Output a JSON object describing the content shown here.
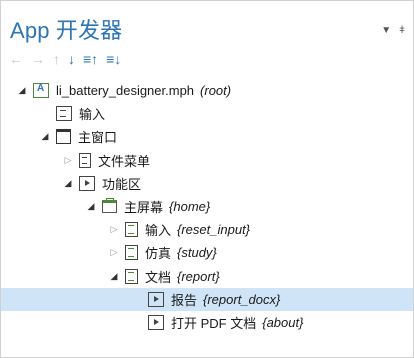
{
  "header": {
    "app": "App",
    "title": "开发器",
    "pin_icon": "pin-icon",
    "dropdown_icon": "chevron-down-icon"
  },
  "toolbar": {
    "buttons": [
      {
        "name": "back",
        "glyph": "←",
        "enabled": false
      },
      {
        "name": "forward",
        "glyph": "→",
        "enabled": false
      },
      {
        "name": "move-up",
        "glyph": "↑",
        "enabled": false
      },
      {
        "name": "move-down",
        "glyph": "↓",
        "enabled": true
      },
      {
        "name": "expand-all",
        "glyph": "≡↑",
        "enabled": true
      },
      {
        "name": "collapse-all",
        "glyph": "≡↓",
        "enabled": true
      }
    ]
  },
  "tree": [
    {
      "label": "li_battery_designer.mph",
      "tag": "(root)",
      "icon": "app-icon",
      "toggle": "open",
      "level": 0
    },
    {
      "label": "输入",
      "tag": "",
      "icon": "form-icon",
      "toggle": "none",
      "level": 1
    },
    {
      "label": "主窗口",
      "tag": "",
      "icon": "window-icon",
      "toggle": "open",
      "level": 1
    },
    {
      "label": "文件菜单",
      "tag": "",
      "icon": "menu-icon",
      "toggle": "closed",
      "level": 2
    },
    {
      "label": "功能区",
      "tag": "",
      "icon": "ribbon-icon",
      "toggle": "open",
      "level": 2
    },
    {
      "label": "主屏幕",
      "tag": "{home}",
      "icon": "screen-icon",
      "toggle": "open",
      "level": 3
    },
    {
      "label": "输入",
      "tag": "{reset_input}",
      "icon": "page-icon",
      "toggle": "closed",
      "level": 4
    },
    {
      "label": "仿真",
      "tag": "{study}",
      "icon": "page-icon",
      "toggle": "closed",
      "level": 4
    },
    {
      "label": "文档",
      "tag": "{report}",
      "icon": "page-icon",
      "toggle": "open",
      "level": 4
    },
    {
      "label": "报告",
      "tag": "{report_docx}",
      "icon": "ribbon-icon",
      "toggle": "none",
      "level": 5,
      "selected": true
    },
    {
      "label": "打开 PDF 文档",
      "tag": "{about}",
      "icon": "ribbon-icon",
      "toggle": "none",
      "level": 5
    }
  ],
  "colors": {
    "accent": "#2e75b6",
    "selection": "#cfe4f7"
  }
}
